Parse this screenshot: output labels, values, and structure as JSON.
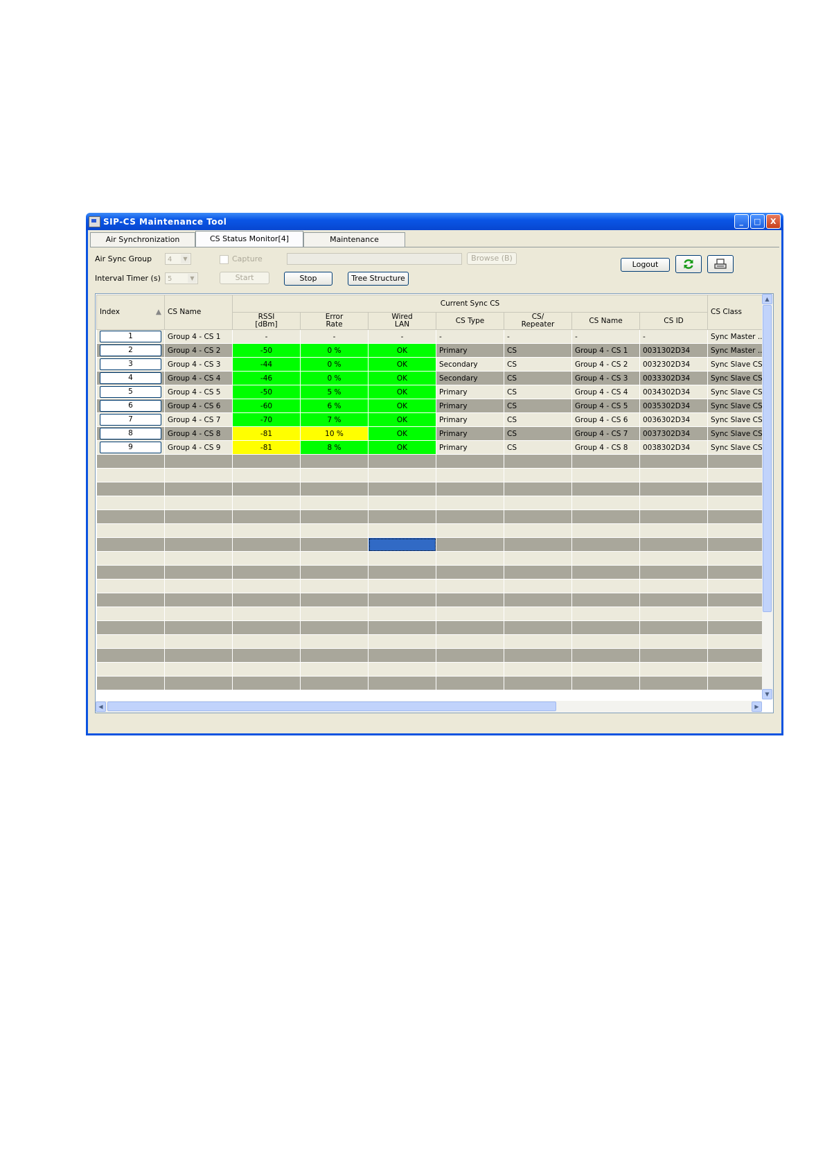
{
  "window": {
    "title": "SIP-CS Maintenance Tool",
    "min": "_",
    "max": "□",
    "close": "X"
  },
  "tabs": [
    {
      "label": "Air Synchronization"
    },
    {
      "label": "CS Status Monitor[4]"
    },
    {
      "label": "Maintenance"
    }
  ],
  "controls": {
    "air_sync_group_label": "Air Sync Group",
    "air_sync_group_value": "4",
    "capture_label": "Capture",
    "browse_label": "Browse (B)",
    "interval_timer_label": "Interval Timer (s)",
    "interval_timer_value": "5",
    "start_label": "Start",
    "stop_label": "Stop",
    "tree_label": "Tree Structure",
    "logout_label": "Logout",
    "refresh_icon": "refresh-icon",
    "print_icon": "print-icon"
  },
  "grid": {
    "headers": {
      "index": "Index",
      "cs_name": "CS Name",
      "current_sync": "Current Sync CS",
      "cs_class": "CS Class",
      "rssi_1": "RSSI",
      "rssi_2": "[dBm]",
      "err_1": "Error",
      "err_2": "Rate",
      "lan_1": "Wired",
      "lan_2": "LAN",
      "cs_type": "CS Type",
      "rep_1": "CS/",
      "rep_2": "Repeater",
      "sync_name": "CS Name",
      "cs_id": "CS ID"
    },
    "rows": [
      {
        "index": "1",
        "name": "Group 4 - CS 1",
        "rssi": "-",
        "err": "-",
        "lan": "-",
        "type": "-",
        "rep": "-",
        "sname": "-",
        "id": "-",
        "cls": "Sync Master ..."
      },
      {
        "index": "2",
        "name": "Group 4 - CS 2",
        "rssi": "-50",
        "err": "0 %",
        "lan": "OK",
        "type": "Primary",
        "rep": "CS",
        "sname": "Group 4 - CS 1",
        "id": "0031302D34",
        "cls": "Sync Master ..."
      },
      {
        "index": "3",
        "name": "Group 4 - CS 3",
        "rssi": "-44",
        "err": "0 %",
        "lan": "OK",
        "type": "Secondary",
        "rep": "CS",
        "sname": "Group 4 - CS 2",
        "id": "0032302D34",
        "cls": "Sync Slave CS"
      },
      {
        "index": "4",
        "name": "Group 4 - CS 4",
        "rssi": "-46",
        "err": "0 %",
        "lan": "OK",
        "type": "Secondary",
        "rep": "CS",
        "sname": "Group 4 - CS 3",
        "id": "0033302D34",
        "cls": "Sync Slave CS"
      },
      {
        "index": "5",
        "name": "Group 4 - CS 5",
        "rssi": "-50",
        "err": "5 %",
        "lan": "OK",
        "type": "Primary",
        "rep": "CS",
        "sname": "Group 4 - CS 4",
        "id": "0034302D34",
        "cls": "Sync Slave CS"
      },
      {
        "index": "6",
        "name": "Group 4 - CS 6",
        "rssi": "-60",
        "err": "6 %",
        "lan": "OK",
        "type": "Primary",
        "rep": "CS",
        "sname": "Group 4 - CS 5",
        "id": "0035302D34",
        "cls": "Sync Slave CS"
      },
      {
        "index": "7",
        "name": "Group 4 - CS 7",
        "rssi": "-70",
        "err": "7 %",
        "lan": "OK",
        "type": "Primary",
        "rep": "CS",
        "sname": "Group 4 - CS 6",
        "id": "0036302D34",
        "cls": "Sync Slave CS"
      },
      {
        "index": "8",
        "name": "Group 4 - CS 8",
        "rssi": "-81",
        "err": "10 %",
        "lan": "OK",
        "type": "Primary",
        "rep": "CS",
        "sname": "Group 4 - CS 7",
        "id": "0037302D34",
        "cls": "Sync Slave CS"
      },
      {
        "index": "9",
        "name": "Group 4 - CS 9",
        "rssi": "-81",
        "err": "8 %",
        "lan": "OK",
        "type": "Primary",
        "rep": "CS",
        "sname": "Group 4 - CS 8",
        "id": "0038302D34",
        "cls": "Sync Slave CS"
      }
    ],
    "cell_colors": {
      "rows_2": {
        "rssi": "g",
        "err": "g"
      },
      "rows_3": {
        "rssi": "g",
        "err": "g"
      },
      "rows_4": {
        "rssi": "g",
        "err": "g"
      },
      "rows_5": {
        "rssi": "g",
        "err": "g"
      },
      "rows_6": {
        "rssi": "g",
        "err": "g"
      },
      "rows_7": {
        "rssi": "g",
        "err": "g"
      },
      "rows_8": {
        "rssi": "y",
        "err": "y"
      },
      "rows_9": {
        "rssi": "y",
        "err": "g"
      }
    },
    "empty_rows": 17,
    "colors": {
      "ok": "#00ff00",
      "warn": "#ffff00",
      "row_light": "#eceadc",
      "row_dark": "#a9a79b",
      "selection": "#316ac5"
    }
  }
}
